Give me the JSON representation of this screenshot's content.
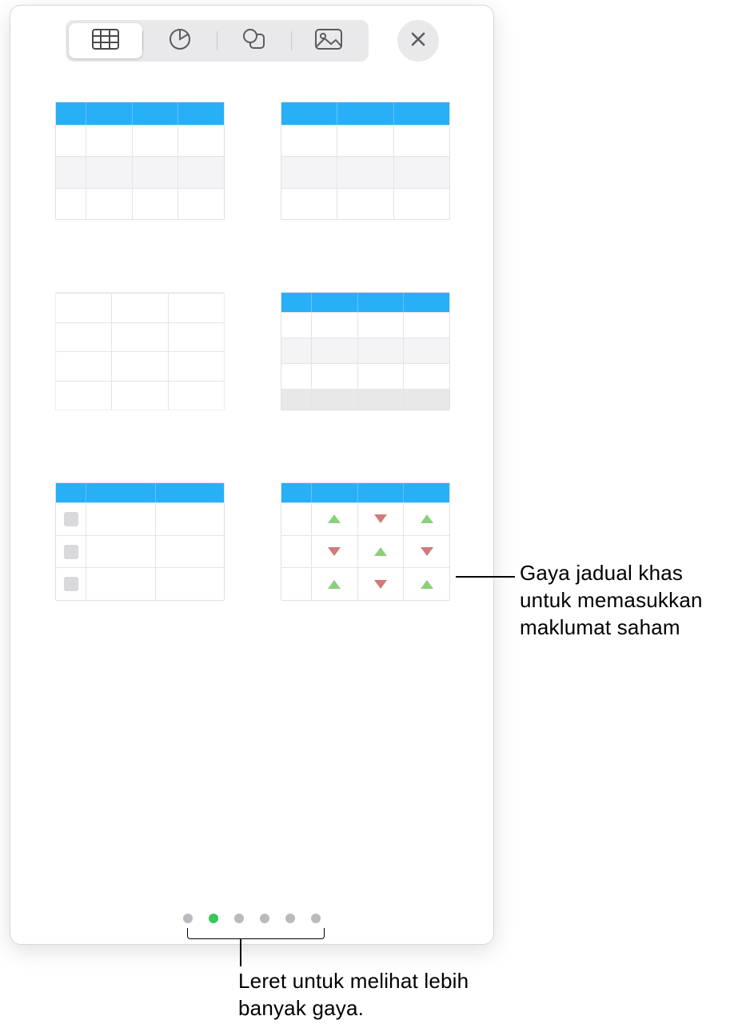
{
  "toolbar": {
    "tabs": [
      "table",
      "chart",
      "shape",
      "media"
    ],
    "active_tab_index": 0
  },
  "styles": [
    {
      "id": "blue-header-rowcol"
    },
    {
      "id": "blue-header-basic"
    },
    {
      "id": "plain-grid"
    },
    {
      "id": "blue-header-footer"
    },
    {
      "id": "checklist"
    },
    {
      "id": "stock-arrows"
    }
  ],
  "pagination": {
    "page_count": 6,
    "active_index": 1
  },
  "callouts": {
    "stock": "Gaya jadual khas untuk memasukkan maklumat saham",
    "swipe": "Leret untuk melihat lebih banyak gaya."
  }
}
